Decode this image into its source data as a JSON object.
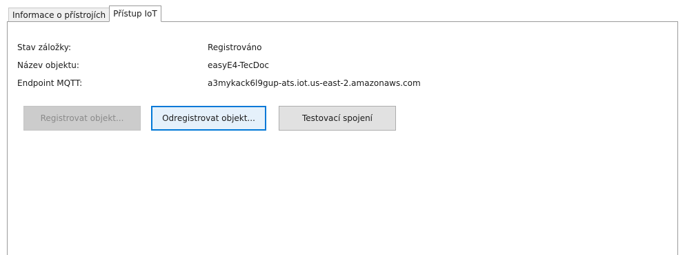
{
  "tabs": [
    {
      "label": "Informace o přístrojích",
      "active": false
    },
    {
      "label": "Přístup IoT",
      "active": true
    }
  ],
  "info": {
    "status_label": "Stav záložky:",
    "status_value": "Registrováno",
    "object_name_label": "Název objektu:",
    "object_name_value": "easyE4-TecDoc",
    "endpoint_label": "Endpoint MQTT:",
    "endpoint_value": "a3mykack6l9gup-ats.iot.us-east-2.amazonaws.com"
  },
  "buttons": {
    "register_label": "Registrovat objekt...",
    "register_enabled": false,
    "unregister_label": "Odregistrovat objekt...",
    "unregister_focused": true,
    "test_label": "Testovací spojení"
  },
  "colors": {
    "focus_border": "#0078d7",
    "focus_fill": "#e5f1fb",
    "disabled_fill": "#cccccc",
    "button_fill": "#e1e1e1"
  }
}
